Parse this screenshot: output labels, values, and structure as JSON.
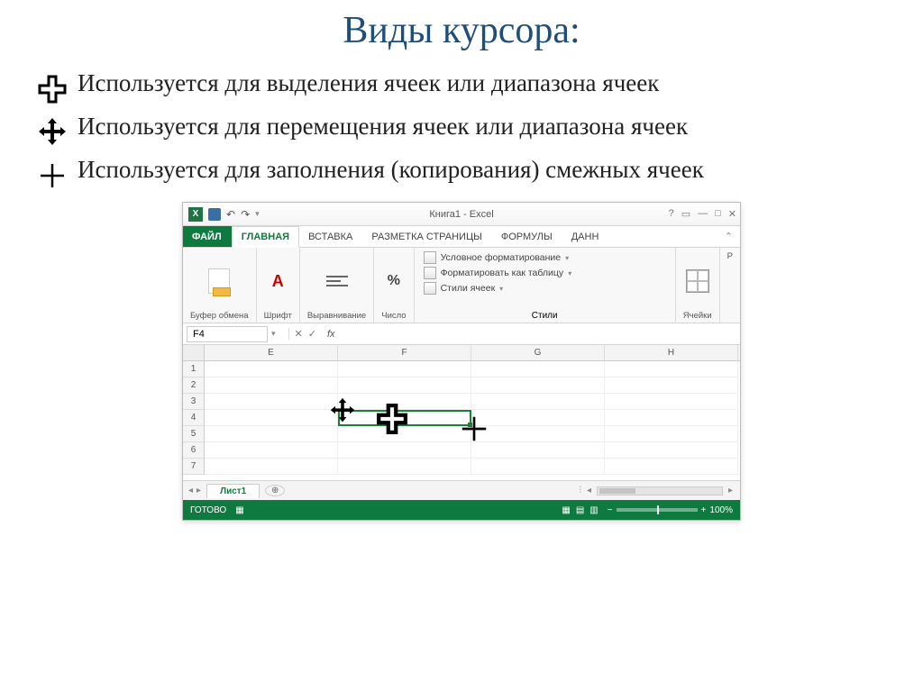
{
  "title": "Виды курсора:",
  "items": [
    {
      "desc": "Используется для выделения ячеек или диапазона ячеек"
    },
    {
      "desc": "Используется для перемещения ячеек или диапазона ячеек"
    },
    {
      "desc": "Используется для заполнения (копирования) смежных ячеек"
    }
  ],
  "excel": {
    "windowTitle": "Книга1 - Excel",
    "tabs": {
      "file": "ФАЙЛ",
      "home": "ГЛАВНАЯ",
      "insert": "ВСТАВКА",
      "layout": "РАЗМЕТКА СТРАНИЦЫ",
      "formulas": "ФОРМУЛЫ",
      "data": "ДАНН"
    },
    "ribbon": {
      "clipboard": "Буфер обмена",
      "font": "Шрифт",
      "alignment": "Выравнивание",
      "number": "Число",
      "stylesLabel": "Стили",
      "condFmt": "Условное форматирование",
      "fmtTable": "Форматировать как таблицу",
      "cellStyles": "Стили ячеек",
      "cells": "Ячейки",
      "edit": "Р"
    },
    "namebox": "F4",
    "fx": "fx",
    "cols": [
      "E",
      "F",
      "G",
      "H"
    ],
    "rows": [
      "1",
      "2",
      "3",
      "4",
      "5",
      "6",
      "7"
    ],
    "sheet": "Лист1",
    "addSheet": "⊕",
    "status": "ГОТОВО",
    "zoom": "100%"
  }
}
